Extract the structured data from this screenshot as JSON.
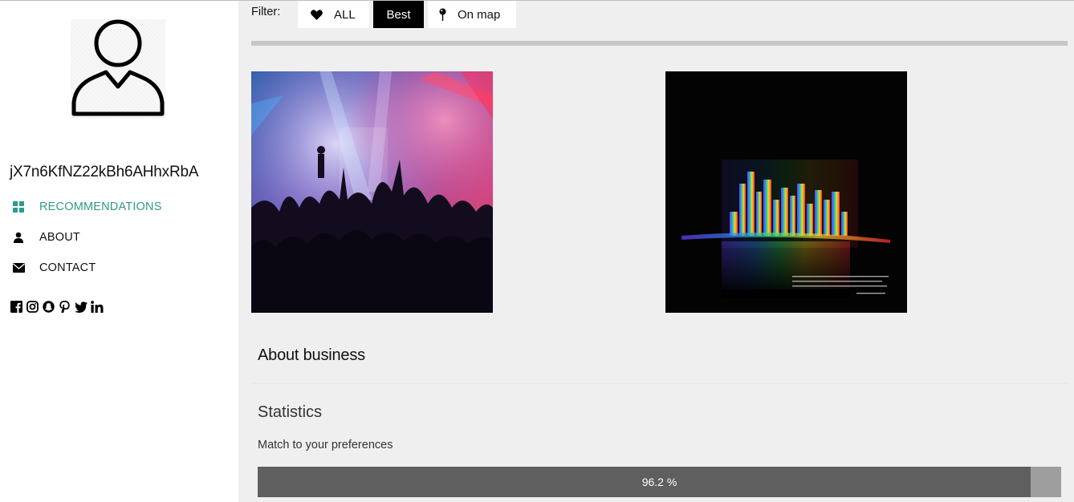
{
  "profile": {
    "username": "jX7n6KfNZ22kBh6AHhxRbA",
    "avatar_icon": "user-outline-icon"
  },
  "nav": {
    "items": [
      {
        "label": "RECOMMENDATIONS",
        "icon": "grid-icon",
        "active": true
      },
      {
        "label": "ABOUT",
        "icon": "user-icon",
        "active": false
      },
      {
        "label": "CONTACT",
        "icon": "envelope-icon",
        "active": false
      }
    ],
    "active_color": "#2f9b8b"
  },
  "social": [
    "facebook-icon",
    "instagram-icon",
    "snapchat-icon",
    "pinterest-icon",
    "twitter-icon",
    "linkedin-icon"
  ],
  "filter": {
    "label": "Filter:",
    "buttons": [
      {
        "label": "ALL",
        "icon": "heart-icon",
        "selected": false
      },
      {
        "label": "Best",
        "icon": "",
        "selected": true
      },
      {
        "label": "On map",
        "icon": "map-pin-icon",
        "selected": false
      }
    ]
  },
  "photos": [
    {
      "subject": "concert crowd under stage lights"
    },
    {
      "subject": "neon city skyline at night with quote"
    }
  ],
  "about": {
    "title": "About business"
  },
  "statistics": {
    "title": "Statistics",
    "match_label": "Match to your preferences",
    "match_value": 96.2,
    "match_text": "96.2 %"
  }
}
